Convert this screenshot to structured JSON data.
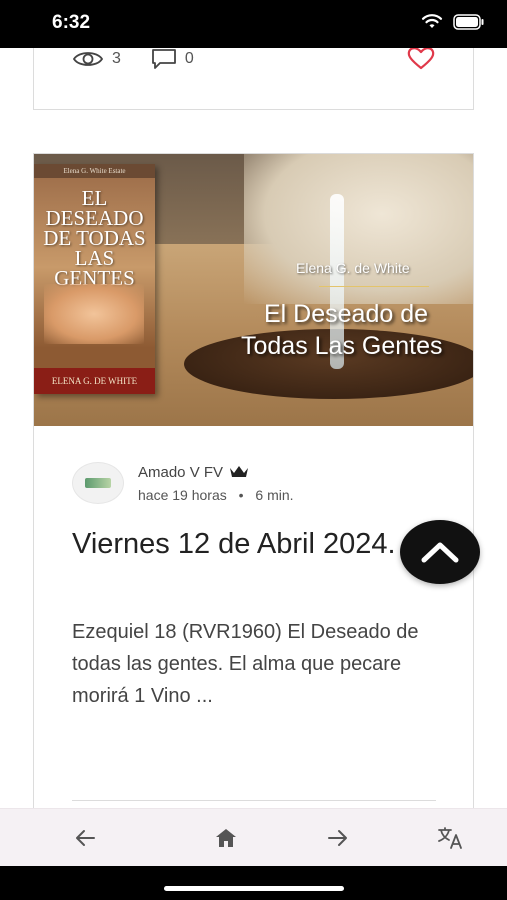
{
  "status_bar": {
    "time": "6:32"
  },
  "previous_post": {
    "views": "3",
    "comments": "0"
  },
  "banner": {
    "book_top_text": "Elena G. White Estate",
    "book_title": "EL DESEADO DE TODAS LAS GENTES",
    "book_author": "ELENA G. DE WHITE",
    "author": "Elena G. de White",
    "title_line1": "El Deseado de",
    "title_line2": "Todas Las Gentes"
  },
  "post": {
    "author_name": "Amado V FV",
    "time_ago": "hace 19 horas",
    "separator": "•",
    "read_time": "6 min.",
    "title": "Viernes 12 de Abril 2024.",
    "excerpt": "Ezequiel 18 (RVR1960) El Deseado de todas las gentes. El alma que pecare morirá 1 Vino ..."
  },
  "icons": {
    "views": "eye-icon",
    "comments": "comment-icon",
    "like": "heart-icon",
    "crown": "crown-icon",
    "scroll_top": "chevron-up-icon",
    "back": "arrow-left-icon",
    "home": "home-icon",
    "forward": "arrow-right-icon",
    "translate": "translate-icon"
  },
  "colors": {
    "heart": "#e0394a",
    "fab": "#111111",
    "nav_bg": "#f5f1f4"
  }
}
